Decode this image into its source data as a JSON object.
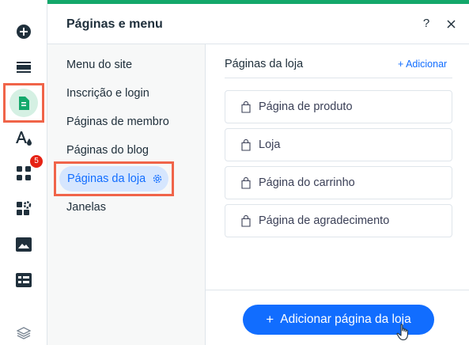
{
  "rail": {
    "badge_count": "5",
    "items": [
      "add-icon",
      "sections-icon",
      "pages-icon",
      "theme-icon",
      "apps-icon",
      "business-icon",
      "media-icon",
      "cms-icon",
      "layers-icon"
    ]
  },
  "panel": {
    "title": "Páginas e menu",
    "help": "?",
    "accent_color": "#14a86b"
  },
  "nav": {
    "items": [
      {
        "label": "Menu do site"
      },
      {
        "label": "Inscrição e login"
      },
      {
        "label": "Páginas de membro"
      },
      {
        "label": "Páginas do blog"
      },
      {
        "label": "Páginas da loja"
      },
      {
        "label": "Janelas"
      }
    ]
  },
  "content": {
    "section_title": "Páginas da loja",
    "add_link": "+ Adicionar",
    "pages": [
      {
        "label": "Página de produto"
      },
      {
        "label": "Loja"
      },
      {
        "label": "Página do carrinho"
      },
      {
        "label": "Página de agradecimento"
      }
    ],
    "cta_plus": "+",
    "cta_label": "Adicionar página da loja"
  },
  "colors": {
    "primary": "#116dff",
    "active_bg": "#d6e6fe",
    "highlight": "#f06449",
    "badge": "#e62214"
  }
}
